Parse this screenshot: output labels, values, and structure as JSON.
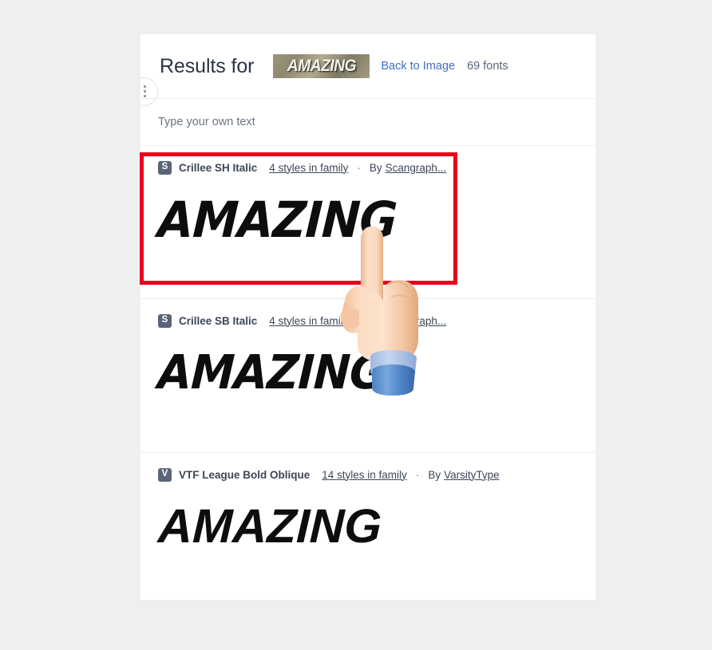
{
  "page": {
    "background_color": "#eef0f0",
    "card_background": "#ffffff"
  },
  "edge_button": {
    "icon": "drag-handle-icon"
  },
  "header": {
    "title": "Results for",
    "query_image_text": "AMAZING",
    "back_link": "Back to Image",
    "font_count": "69 fonts",
    "link_color": "#3f6fc4",
    "count_color": "#59667a"
  },
  "custom_text": {
    "placeholder": "Type your own text",
    "value": ""
  },
  "results": [
    {
      "badge": "S",
      "name": "Crillee SH Italic",
      "styles": "4 styles in family",
      "separator": "·",
      "by_label": "By",
      "foundry": "Scangraph...",
      "sample": "AMAZING"
    },
    {
      "badge": "S",
      "name": "Crillee SB Italic",
      "styles": "4 styles in family",
      "separator": "·",
      "by_label": "By",
      "foundry": "Scangraph...",
      "sample": "AMAZING"
    },
    {
      "badge": "V",
      "name": "VTF League Bold Oblique",
      "styles": "14 styles in family",
      "separator": "·",
      "by_label": "By",
      "foundry": "VarsityType",
      "sample": "AMAZING"
    }
  ],
  "annotation": {
    "color": "#e8001c",
    "target": "Crillee SH Italic result row"
  },
  "cursor": {
    "icon": "pointing-hand-cursor"
  }
}
